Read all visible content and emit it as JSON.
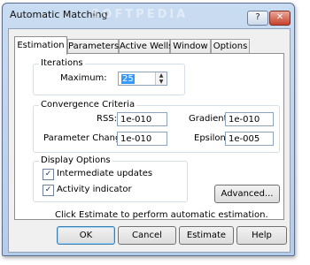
{
  "window": {
    "title": "Automatic Matching",
    "watermark": "SOFTPEDIA",
    "controls": {
      "help": "?",
      "close": "✕"
    }
  },
  "tabs": [
    {
      "label": "Estimation",
      "active": true
    },
    {
      "label": "Parameters"
    },
    {
      "label": "Active Wells"
    },
    {
      "label": "Window"
    },
    {
      "label": "Options"
    }
  ],
  "iterations": {
    "group_label": "Iterations",
    "maximum_label": "Maximum:",
    "maximum_value": "25"
  },
  "convergence": {
    "group_label": "Convergence Criteria",
    "rss_label": "RSS:",
    "rss_value": "1e-010",
    "gradient_label": "Gradient:",
    "gradient_value": "1e-010",
    "param_change_label": "Parameter Change:",
    "param_change_value": "1e-010",
    "epsilon_label": "Epsilon:",
    "epsilon_value": "1e-005"
  },
  "display": {
    "group_label": "Display Options",
    "intermediate_label": "Intermediate updates",
    "intermediate_checked": true,
    "activity_label": "Activity indicator",
    "activity_checked": true
  },
  "advanced_label": "Advanced...",
  "hint": "Click Estimate to perform automatic estimation.",
  "buttons": {
    "ok": "OK",
    "cancel": "Cancel",
    "estimate": "Estimate",
    "help": "Help"
  },
  "glyphs": {
    "check": "✓",
    "spin_up": "▲",
    "spin_down": "▼"
  }
}
